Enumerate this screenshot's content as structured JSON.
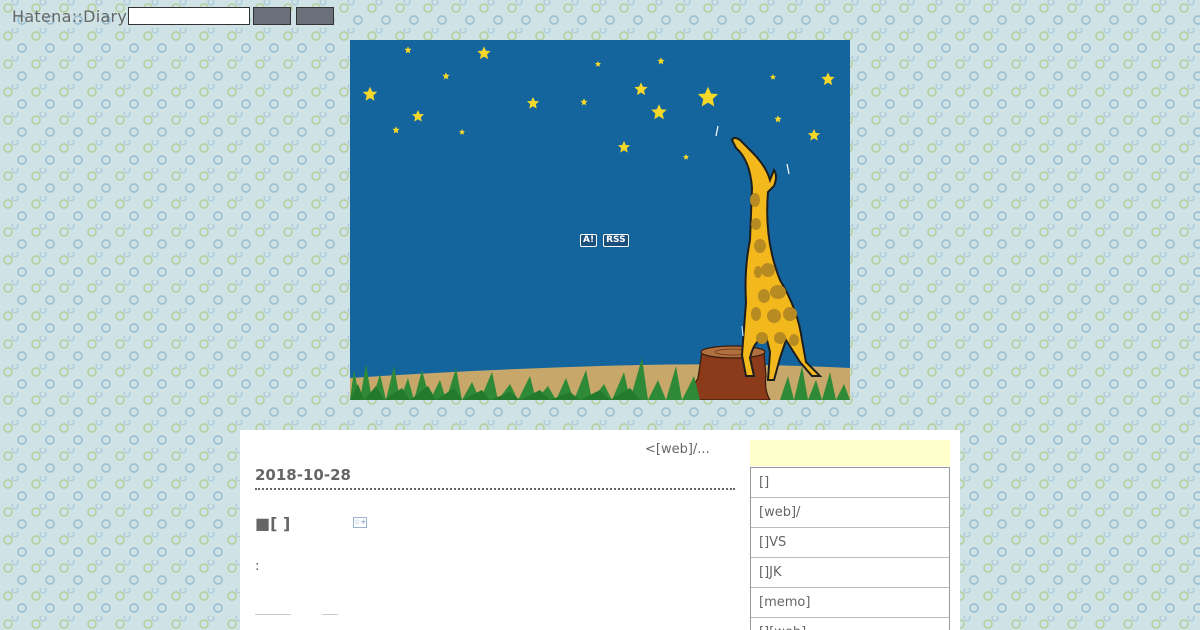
{
  "header": {
    "logo": "Hatena::Diary",
    "search": {
      "value": "",
      "placeholder": ""
    },
    "buttons": [
      "",
      ""
    ]
  },
  "banner": {
    "badges": [
      "A!",
      "RSS"
    ]
  },
  "content": {
    "pager": "<[web]/...",
    "date": "2018-10-28",
    "section_title": "■[ ]",
    "star_button": "☆+",
    "body": ":"
  },
  "sidebar": {
    "header": "",
    "items": [
      "[]",
      "[web]/",
      "[]VS",
      "[]JK",
      "[memo]",
      "[][web]"
    ]
  },
  "colors": {
    "sky": "#14659e",
    "star": "#f5d82a",
    "grass": "#2e8a36",
    "ground": "#c8a86a",
    "stump": "#8b3a1a",
    "giraffe": "#f2b81c",
    "sidebar_header": "#ffffcc"
  }
}
